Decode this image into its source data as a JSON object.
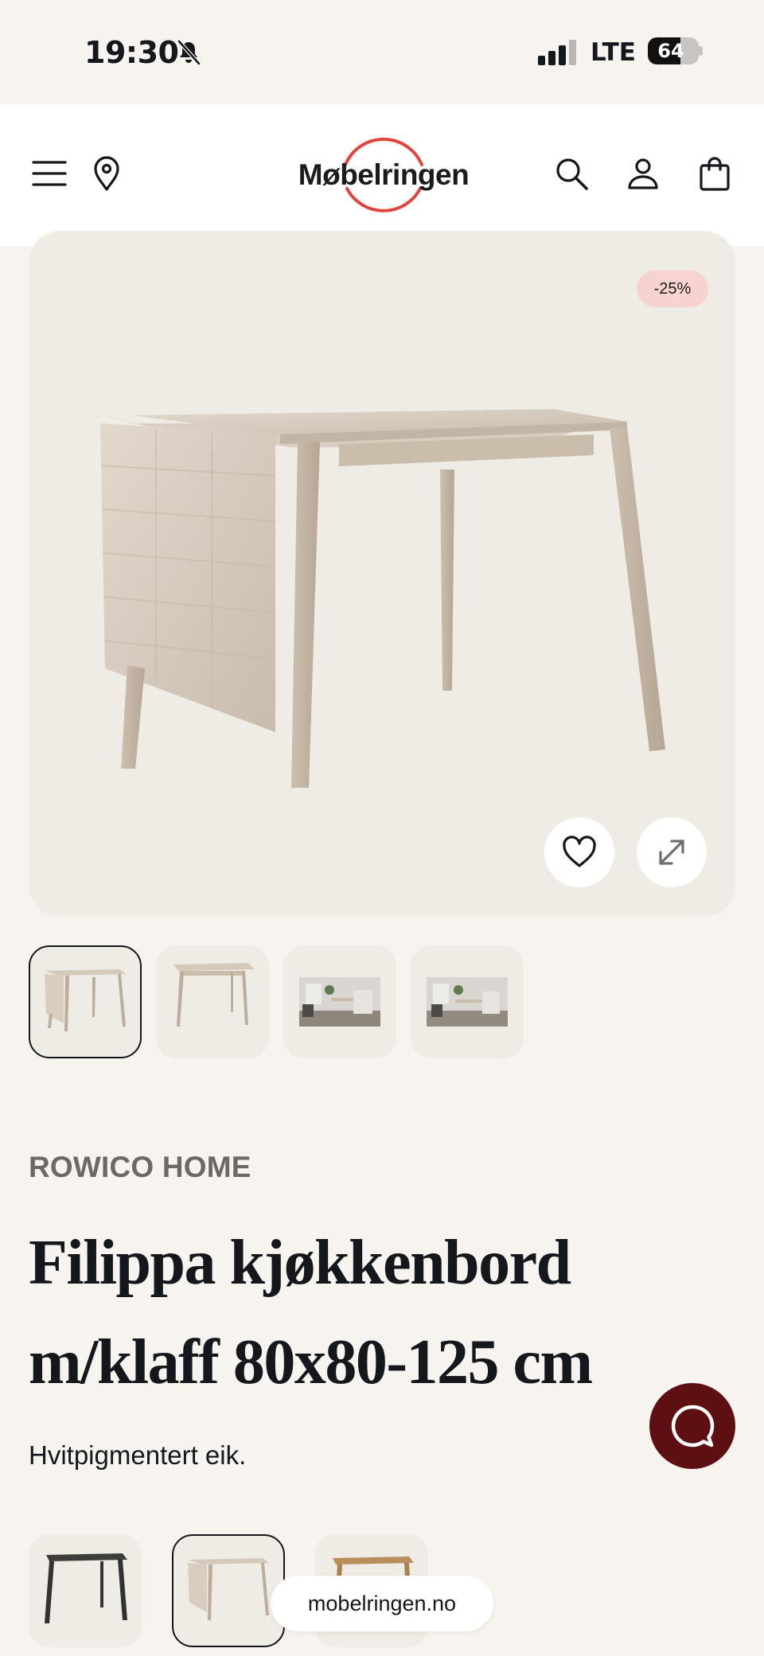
{
  "status_bar": {
    "time": "19:30",
    "network": "LTE",
    "battery_level": "64",
    "battery_fraction": 0.64,
    "icons": [
      "bell-slash-icon",
      "signal-bars-icon",
      "battery-icon"
    ]
  },
  "header": {
    "logo_text": "Møbelringen",
    "icons": [
      "menu-icon",
      "location-pin-icon",
      "search-icon",
      "user-icon",
      "shopping-bag-icon"
    ],
    "logo_ring_color": "#e2443d"
  },
  "product": {
    "discount_badge": "-25%",
    "brand": "ROWICO HOME",
    "title_line1": "Filippa kjøkkenbord",
    "title_line2": "m/klaff 80x80-125 cm",
    "subtitle": "Hvitpigmentert eik.",
    "gallery_count": 4,
    "active_gallery_index": 0,
    "variant_active_index": 1
  },
  "browser": {
    "url": "mobelringen.no"
  },
  "colors": {
    "page_bg": "#f7f3ef",
    "card_bg": "#efebe5",
    "badge_bg": "#f6d3cf",
    "chat_bg": "#5d0f12",
    "brand_text": "#6f6862"
  }
}
